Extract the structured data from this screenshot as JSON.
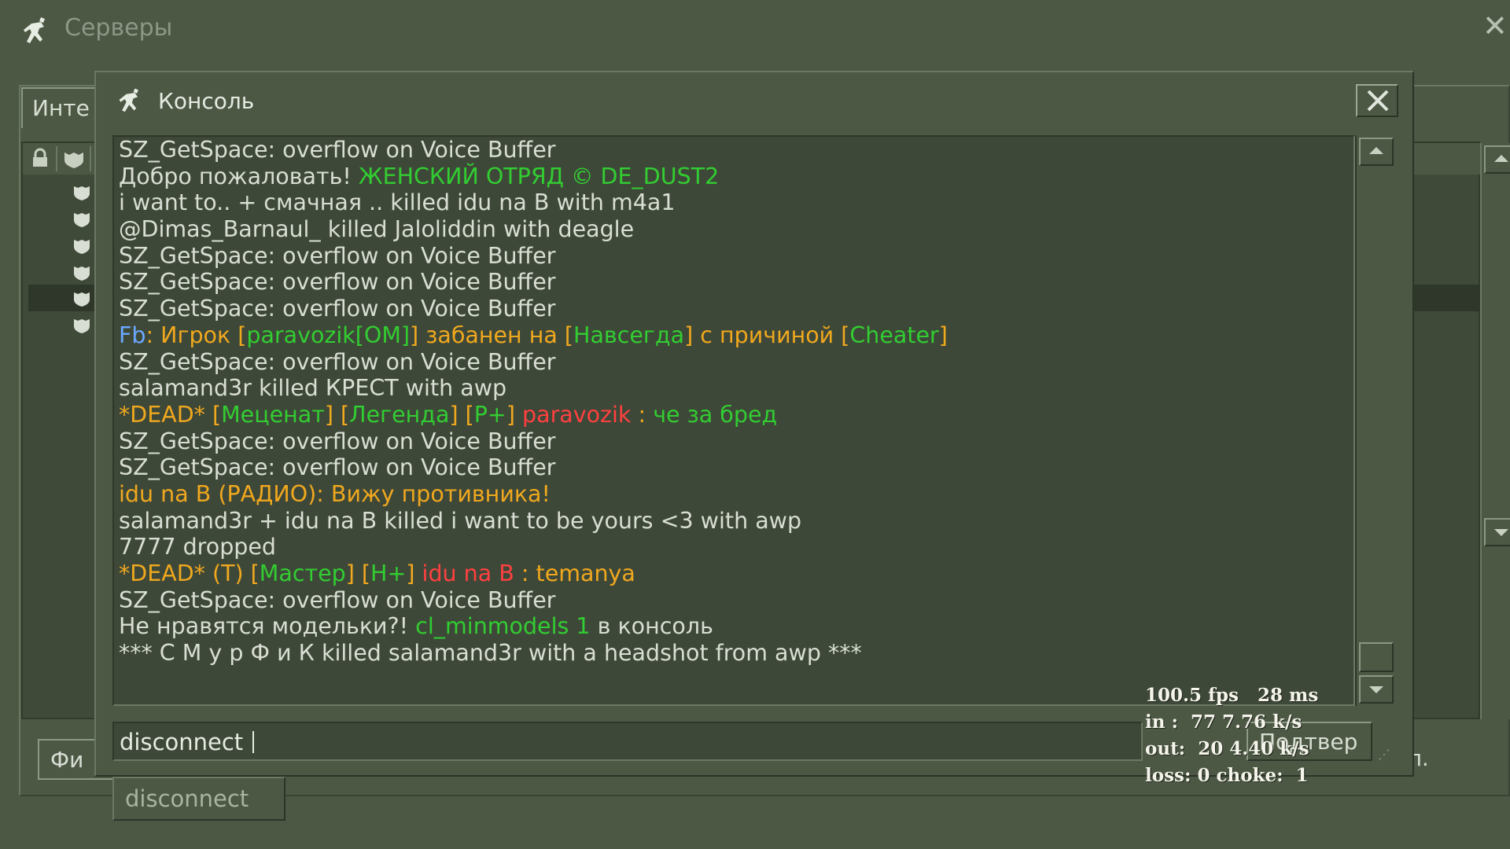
{
  "background_window": {
    "title": "Серверы",
    "close_glyph": "✕",
    "tab_label": "Инте",
    "filter_button_label": "Фи",
    "right_button_fragment": "л."
  },
  "console": {
    "title": "Консоль",
    "lines": [
      [
        {
          "t": "SZ_GetSpace: overflow on Voice Buffer",
          "c": "d"
        }
      ],
      [
        {
          "t": "Добро пожаловать! ",
          "c": "d"
        },
        {
          "t": "ЖЕНСКИЙ ОТРЯД © DE_DUST2",
          "c": "g"
        }
      ],
      [
        {
          "t": "i want to.. + смачная .. killed idu na B with m4a1",
          "c": "d"
        }
      ],
      [
        {
          "t": "@Dimas_Barnaul_ killed Jaloliddin with deagle",
          "c": "d"
        }
      ],
      [
        {
          "t": "SZ_GetSpace: overflow on Voice Buffer",
          "c": "d"
        }
      ],
      [
        {
          "t": "SZ_GetSpace: overflow on Voice Buffer",
          "c": "d"
        }
      ],
      [
        {
          "t": "SZ_GetSpace: overflow on Voice Buffer",
          "c": "d"
        }
      ],
      [
        {
          "t": "Fb",
          "c": "b"
        },
        {
          "t": ": Игрок [",
          "c": "o"
        },
        {
          "t": "paravozik[OM]",
          "c": "g"
        },
        {
          "t": "] забанен на [",
          "c": "o"
        },
        {
          "t": "Навсегда",
          "c": "g"
        },
        {
          "t": "] с причиной [",
          "c": "o"
        },
        {
          "t": "Cheater",
          "c": "g"
        },
        {
          "t": "]",
          "c": "o"
        }
      ],
      [
        {
          "t": "SZ_GetSpace: overflow on Voice Buffer",
          "c": "d"
        }
      ],
      [
        {
          "t": "salamand3r killed КРЕСТ with awp",
          "c": "d"
        }
      ],
      [
        {
          "t": "*DEAD* [",
          "c": "o"
        },
        {
          "t": "Меценат",
          "c": "g"
        },
        {
          "t": "] [",
          "c": "o"
        },
        {
          "t": "Легенда",
          "c": "g"
        },
        {
          "t": "] [",
          "c": "o"
        },
        {
          "t": "P+",
          "c": "g"
        },
        {
          "t": "] ",
          "c": "o"
        },
        {
          "t": "paravozik",
          "c": "r"
        },
        {
          "t": " : ",
          "c": "o"
        },
        {
          "t": "че за бред",
          "c": "g"
        }
      ],
      [
        {
          "t": "SZ_GetSpace: overflow on Voice Buffer",
          "c": "d"
        }
      ],
      [
        {
          "t": "SZ_GetSpace: overflow on Voice Buffer",
          "c": "d"
        }
      ],
      [
        {
          "t": "idu na B (РАДИО): Вижу противника!",
          "c": "o"
        }
      ],
      [
        {
          "t": "salamand3r + idu na B killed i want to be yours <3 with awp",
          "c": "d"
        }
      ],
      [
        {
          "t": "7777 dropped",
          "c": "d"
        }
      ],
      [
        {
          "t": "*DEAD* (T) [",
          "c": "o"
        },
        {
          "t": "Мастер",
          "c": "g"
        },
        {
          "t": "] [",
          "c": "o"
        },
        {
          "t": "H+",
          "c": "g"
        },
        {
          "t": "] ",
          "c": "o"
        },
        {
          "t": "idu na B",
          "c": "r"
        },
        {
          "t": " : temanya",
          "c": "o"
        }
      ],
      [
        {
          "t": "SZ_GetSpace: overflow on Voice Buffer",
          "c": "d"
        }
      ],
      [
        {
          "t": "Не нравятся модельки?! ",
          "c": "d"
        },
        {
          "t": "cl_minmodels 1",
          "c": "g"
        },
        {
          "t": " в консоль",
          "c": "d"
        }
      ],
      [
        {
          "t": "*** С М у р Ф и К killed salamand3r with a headshot from awp ***",
          "c": "d"
        }
      ]
    ],
    "input_value": "disconnect ",
    "submit_label": "Подтвер",
    "suggestion": "disconnect",
    "grip": "⋰"
  },
  "netgraph": {
    "fps": "100.5 fps",
    "ms": "28 ms",
    "in": "in :  77 7.76 k/s",
    "out": "out:  20 4.40 k/s",
    "loss": "loss: 0 choke:  1"
  },
  "colors": {
    "default": "#d8ded3",
    "green": "#32cd32",
    "orange": "#f0a81e",
    "red": "#ff4040",
    "blue": "#6aa8ff",
    "window_bg": "#4c5844",
    "log_bg": "#3e4838"
  },
  "icons": {
    "app": "counter-strike-runner-icon",
    "close": "close-icon",
    "lock": "lock-icon",
    "shield": "shield-icon"
  }
}
